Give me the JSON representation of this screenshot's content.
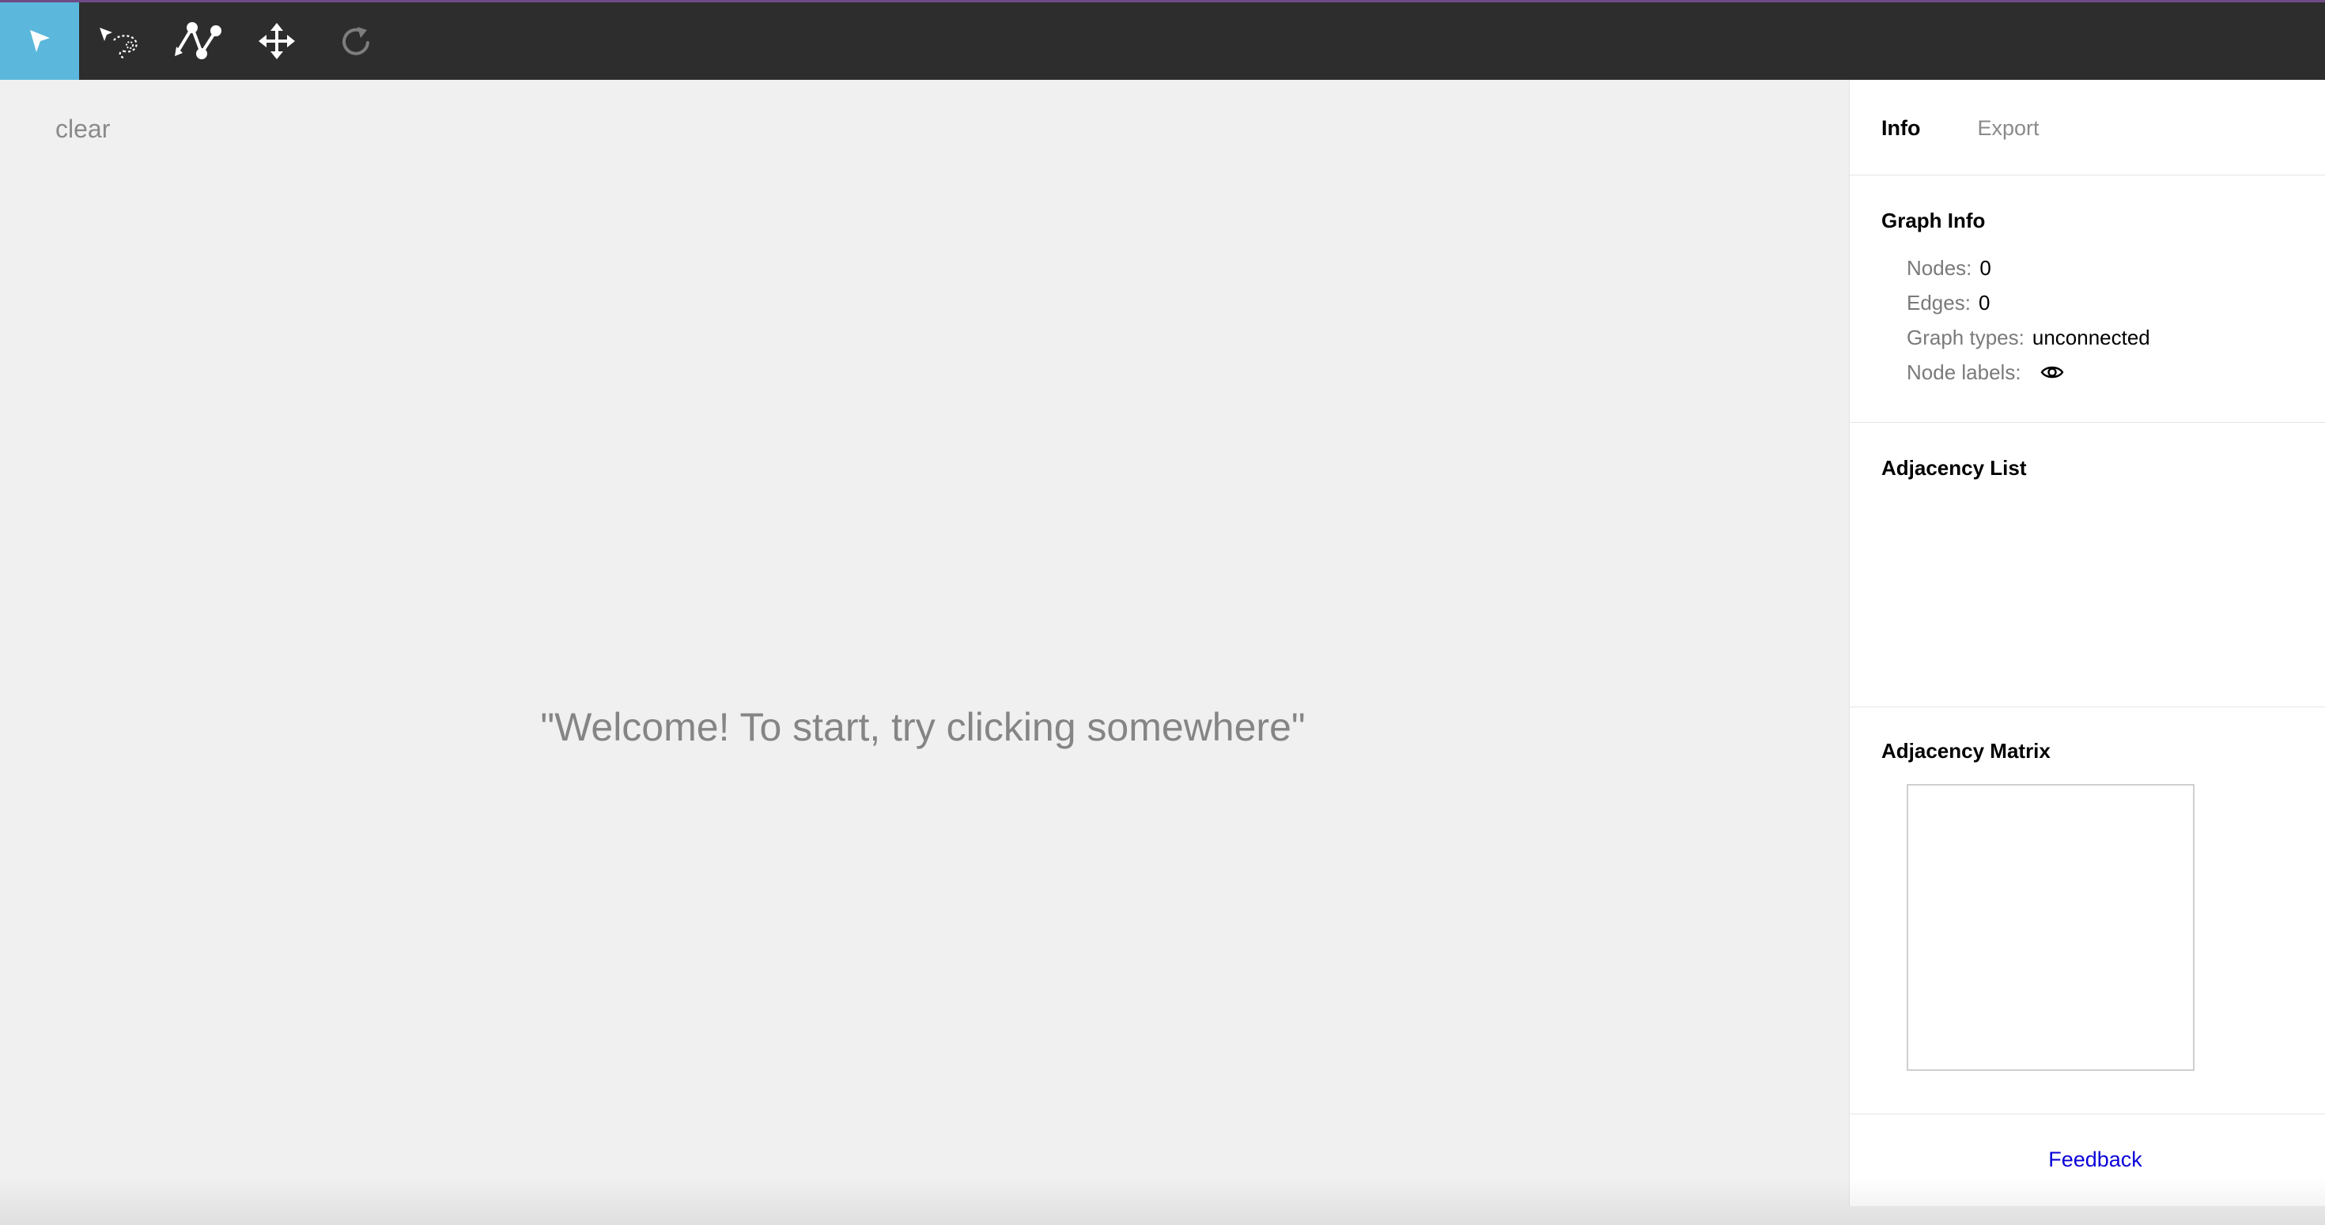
{
  "toolbar": {
    "tools": [
      {
        "icon": "pointer-icon",
        "active": true
      },
      {
        "icon": "lasso-select-icon",
        "active": false
      },
      {
        "icon": "add-node-edge-icon",
        "active": false
      },
      {
        "icon": "move-icon",
        "active": false
      },
      {
        "icon": "redo-icon",
        "active": false
      }
    ],
    "active_color": "#5bb8dc",
    "background_color": "#2d2d2d"
  },
  "canvas": {
    "clear_label": "clear",
    "welcome_message": "\"Welcome! To start, try clicking somewhere\""
  },
  "sidebar": {
    "tabs": [
      {
        "label": "Info",
        "active": true
      },
      {
        "label": "Export",
        "active": false
      }
    ],
    "graph_info": {
      "title": "Graph Info",
      "nodes_label": "Nodes:",
      "nodes_value": "0",
      "edges_label": "Edges:",
      "edges_value": "0",
      "types_label": "Graph types:",
      "types_value": "unconnected",
      "node_labels_label": "Node labels:",
      "node_labels_icon": "eye-icon"
    },
    "adjacency_list": {
      "title": "Adjacency List"
    },
    "adjacency_matrix": {
      "title": "Adjacency Matrix"
    },
    "feedback_label": "Feedback",
    "link_color": "#0a00d9"
  }
}
